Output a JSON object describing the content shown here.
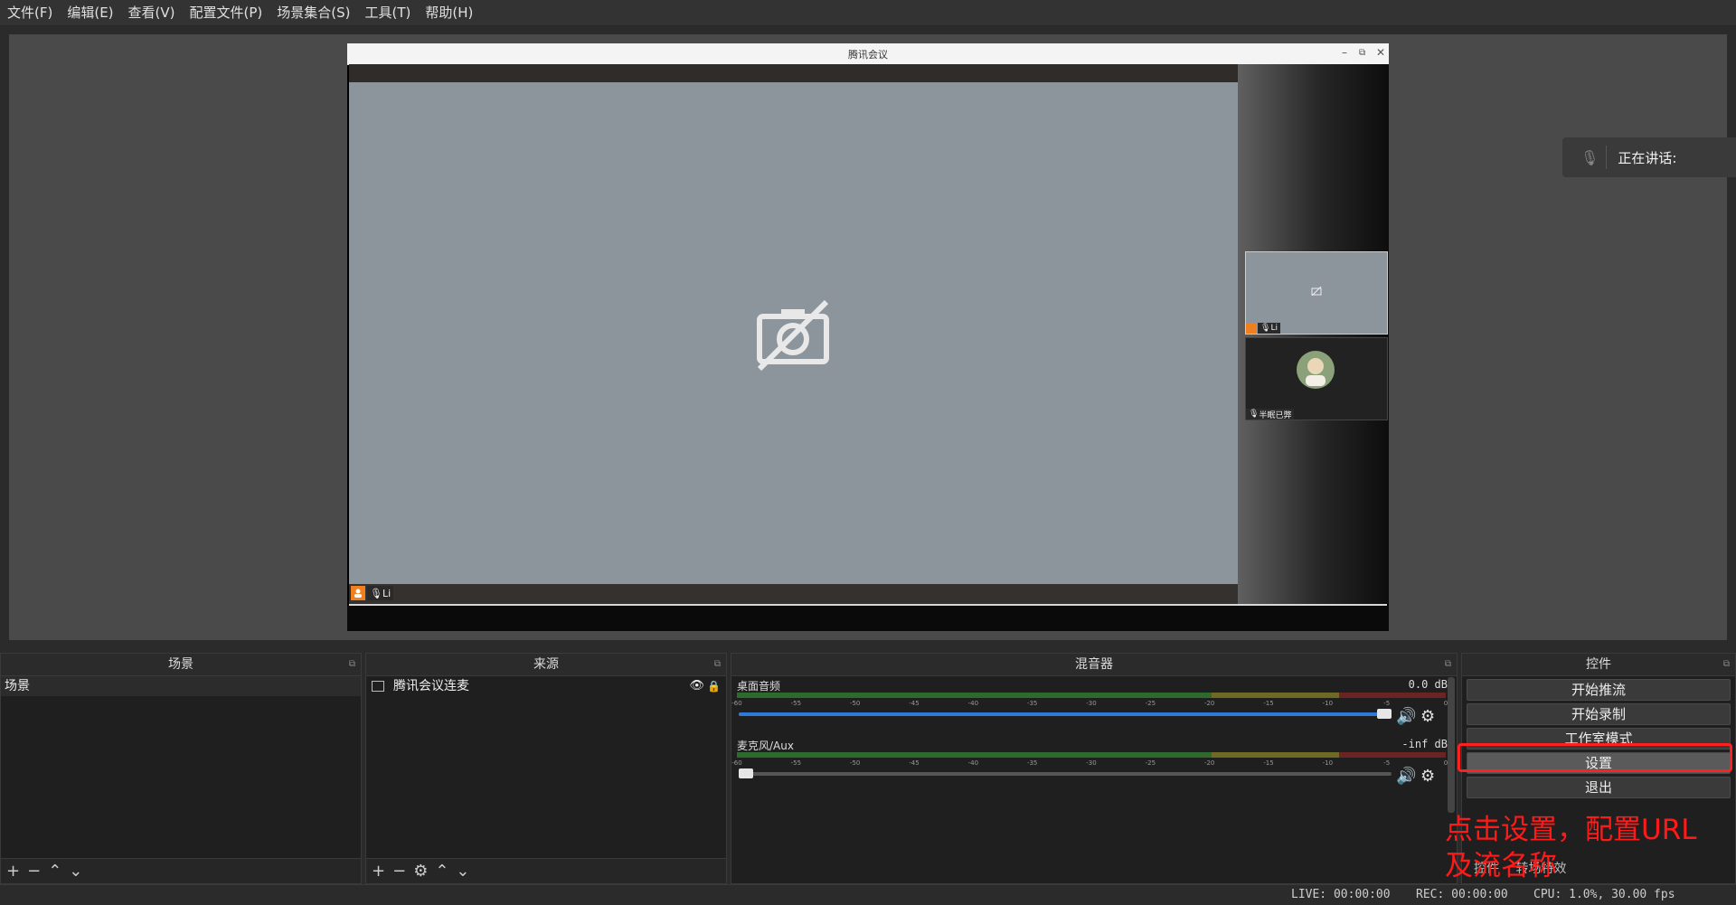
{
  "menu": {
    "items": [
      "文件(F)",
      "编辑(E)",
      "查看(V)",
      "配置文件(P)",
      "场景集合(S)",
      "工具(T)",
      "帮助(H)"
    ]
  },
  "preview": {
    "window_title": "腾讯会议",
    "main_user_tag": "Li",
    "thumb1_tag": "Li",
    "thumb2_tag": "半眠已弊",
    "speaking_label": "正在讲话:"
  },
  "scenes": {
    "header": "场景",
    "items": [
      "场景"
    ]
  },
  "sources": {
    "header": "来源",
    "items": [
      "腾讯会议连麦"
    ]
  },
  "mixer": {
    "header": "混音器",
    "channels": [
      {
        "name": "桌面音频",
        "db": "0.0 dB",
        "volume": 1.0
      },
      {
        "name": "麦克风/Aux",
        "db": "-inf dB",
        "volume": 0.0
      }
    ],
    "ticks": [
      "-60",
      "-55",
      "-50",
      "-45",
      "-40",
      "-35",
      "-30",
      "-25",
      "-20",
      "-15",
      "-10",
      "-5",
      "0"
    ]
  },
  "controls": {
    "header": "控件",
    "buttons": [
      "开始推流",
      "开始录制",
      "工作室模式",
      "设置",
      "退出"
    ],
    "selected": "设置"
  },
  "bottom_tabs": [
    "控件",
    "转场特效"
  ],
  "annotation": {
    "line1": "点击设置，配置URL",
    "line2": "及流名称",
    "color": "#ff1a1a"
  },
  "status": {
    "live": "LIVE: 00:00:00",
    "rec": "REC: 00:00:00",
    "cpu": "CPU: 1.0%, 30.00 fps"
  }
}
